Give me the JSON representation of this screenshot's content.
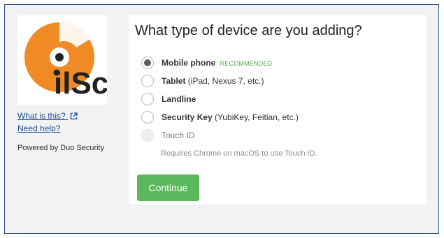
{
  "sidebar": {
    "logo_text": "ilSc",
    "what_is_this": "What is this?",
    "need_help": "Need help?",
    "powered_by": "Powered by Duo Security"
  },
  "main": {
    "title": "What type of device are you adding?",
    "options": [
      {
        "name": "Mobile phone",
        "badge": "RECOMMENDED",
        "detail": "",
        "checked": true,
        "disabled": false
      },
      {
        "name": "Tablet",
        "detail": "(iPad, Nexus 7, etc.)",
        "checked": false,
        "disabled": false
      },
      {
        "name": "Landline",
        "detail": "",
        "checked": false,
        "disabled": false
      },
      {
        "name": "Security Key",
        "detail": "(YubiKey, Feitian, etc.)",
        "checked": false,
        "disabled": false
      },
      {
        "name": "Touch ID",
        "detail": "",
        "checked": false,
        "disabled": true,
        "note": "Requires Chrome on macOS to use Touch ID."
      }
    ],
    "continue_label": "Continue"
  },
  "colors": {
    "accent_green": "#5cb85c",
    "logo_orange": "#f08a24",
    "frame_border": "#2f4e84",
    "link_blue": "#1a4c8c"
  },
  "icons": [
    "external-link-icon",
    "logo-disc-icon"
  ]
}
